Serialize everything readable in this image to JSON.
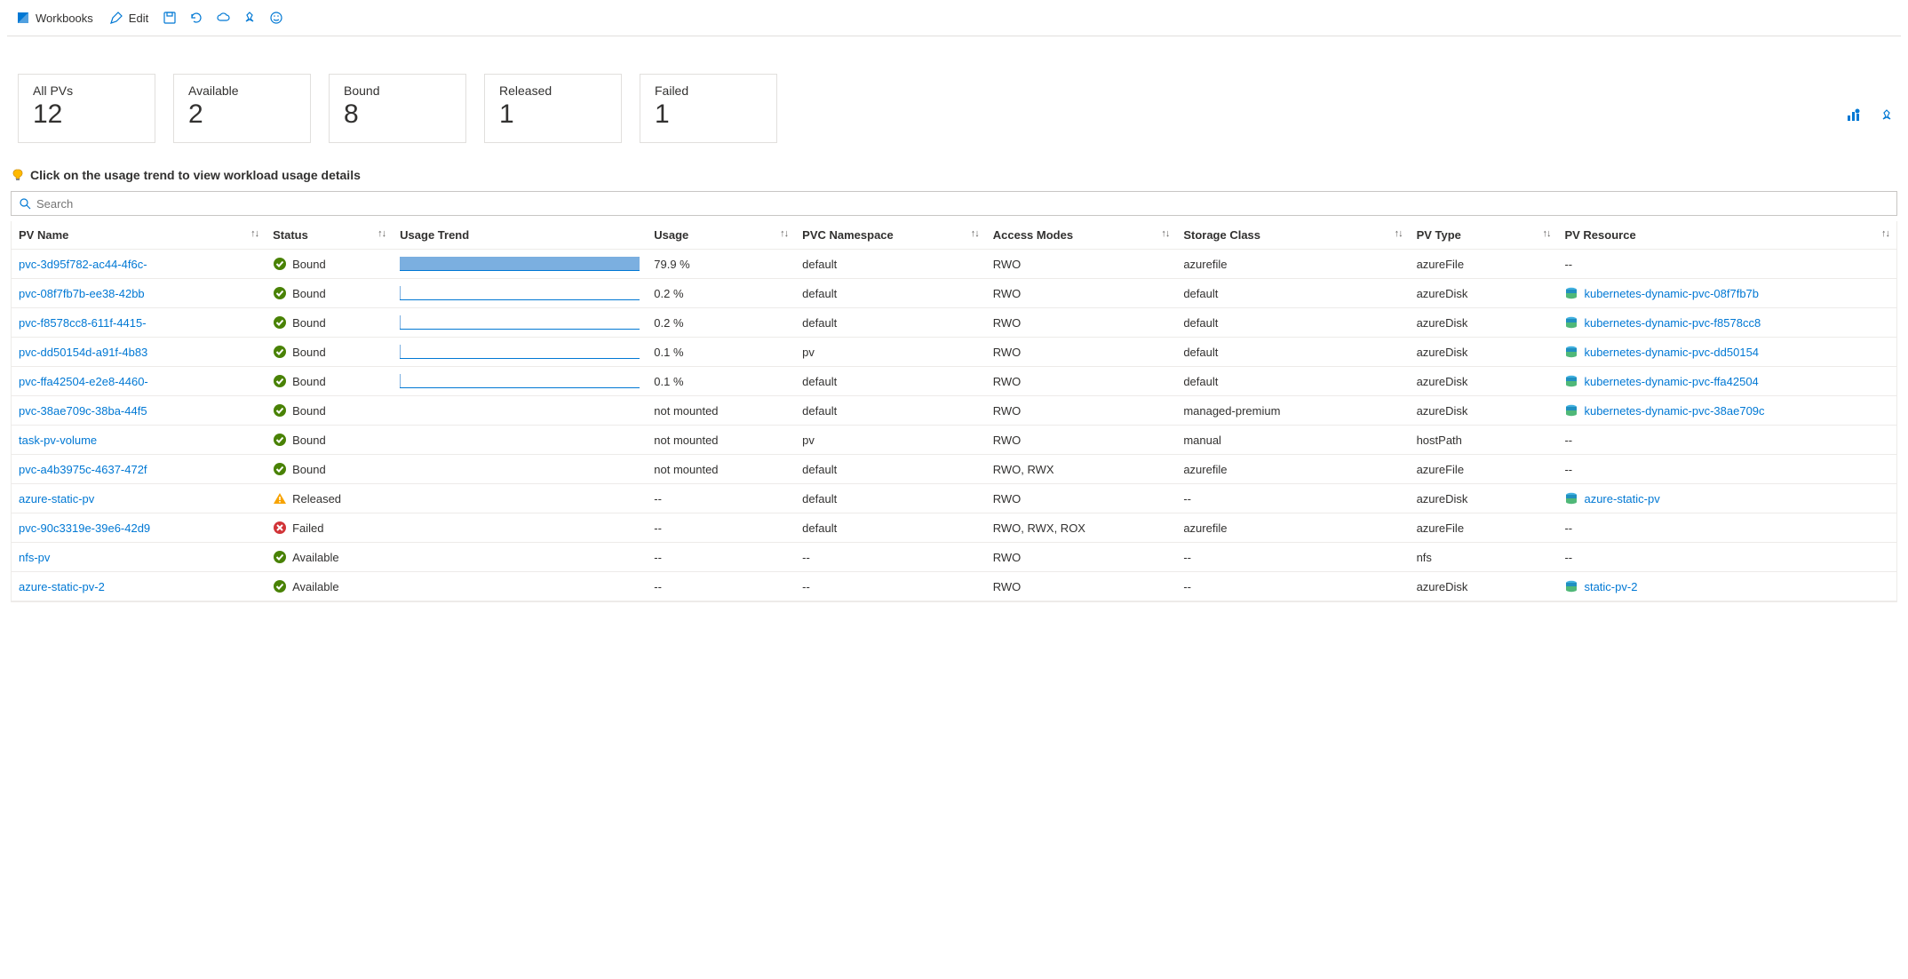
{
  "toolbar": {
    "workbooks_label": "Workbooks",
    "edit_label": "Edit"
  },
  "tiles": [
    {
      "label": "All PVs",
      "value": "12"
    },
    {
      "label": "Available",
      "value": "2"
    },
    {
      "label": "Bound",
      "value": "8"
    },
    {
      "label": "Released",
      "value": "1"
    },
    {
      "label": "Failed",
      "value": "1"
    }
  ],
  "hint": "Click on the usage trend to view workload usage details",
  "search": {
    "placeholder": "Search"
  },
  "columns": {
    "name": "PV Name",
    "status": "Status",
    "trend": "Usage Trend",
    "usage": "Usage",
    "ns": "PVC Namespace",
    "modes": "Access Modes",
    "class": "Storage Class",
    "type": "PV Type",
    "resource": "PV Resource"
  },
  "rows": [
    {
      "name": "pvc-3d95f782-ac44-4f6c-",
      "status": "Bound",
      "status_kind": "ok",
      "usage": "79.9 %",
      "usage_pct": 100,
      "ns": "default",
      "modes": "RWO",
      "class": "azurefile",
      "type": "azureFile",
      "resource": "--",
      "has_res": false
    },
    {
      "name": "pvc-08f7fb7b-ee38-42bb",
      "status": "Bound",
      "status_kind": "ok",
      "usage": "0.2 %",
      "usage_pct": 0.3,
      "ns": "default",
      "modes": "RWO",
      "class": "default",
      "type": "azureDisk",
      "resource": "kubernetes-dynamic-pvc-08f7fb7b",
      "has_res": true
    },
    {
      "name": "pvc-f8578cc8-611f-4415-",
      "status": "Bound",
      "status_kind": "ok",
      "usage": "0.2 %",
      "usage_pct": 0.3,
      "ns": "default",
      "modes": "RWO",
      "class": "default",
      "type": "azureDisk",
      "resource": "kubernetes-dynamic-pvc-f8578cc8",
      "has_res": true
    },
    {
      "name": "pvc-dd50154d-a91f-4b83",
      "status": "Bound",
      "status_kind": "ok",
      "usage": "0.1 %",
      "usage_pct": 0.15,
      "ns": "pv",
      "modes": "RWO",
      "class": "default",
      "type": "azureDisk",
      "resource": "kubernetes-dynamic-pvc-dd50154",
      "has_res": true
    },
    {
      "name": "pvc-ffa42504-e2e8-4460-",
      "status": "Bound",
      "status_kind": "ok",
      "usage": "0.1 %",
      "usage_pct": 0.15,
      "ns": "default",
      "modes": "RWO",
      "class": "default",
      "type": "azureDisk",
      "resource": "kubernetes-dynamic-pvc-ffa42504",
      "has_res": true
    },
    {
      "name": "pvc-38ae709c-38ba-44f5",
      "status": "Bound",
      "status_kind": "ok",
      "usage": "not mounted",
      "usage_pct": null,
      "ns": "default",
      "modes": "RWO",
      "class": "managed-premium",
      "type": "azureDisk",
      "resource": "kubernetes-dynamic-pvc-38ae709c",
      "has_res": true
    },
    {
      "name": "task-pv-volume",
      "status": "Bound",
      "status_kind": "ok",
      "usage": "not mounted",
      "usage_pct": null,
      "ns": "pv",
      "modes": "RWO",
      "class": "manual",
      "type": "hostPath",
      "resource": "--",
      "has_res": false
    },
    {
      "name": "pvc-a4b3975c-4637-472f",
      "status": "Bound",
      "status_kind": "ok",
      "usage": "not mounted",
      "usage_pct": null,
      "ns": "default",
      "modes": "RWO, RWX",
      "class": "azurefile",
      "type": "azureFile",
      "resource": "--",
      "has_res": false
    },
    {
      "name": "azure-static-pv",
      "status": "Released",
      "status_kind": "warn",
      "usage": "--",
      "usage_pct": null,
      "ns": "default",
      "modes": "RWO",
      "class": "--",
      "type": "azureDisk",
      "resource": "azure-static-pv",
      "has_res": true
    },
    {
      "name": "pvc-90c3319e-39e6-42d9",
      "status": "Failed",
      "status_kind": "fail",
      "usage": "--",
      "usage_pct": null,
      "ns": "default",
      "modes": "RWO, RWX, ROX",
      "class": "azurefile",
      "type": "azureFile",
      "resource": "--",
      "has_res": false
    },
    {
      "name": "nfs-pv",
      "status": "Available",
      "status_kind": "ok",
      "usage": "--",
      "usage_pct": null,
      "ns": "--",
      "modes": "RWO",
      "class": "--",
      "type": "nfs",
      "resource": "--",
      "has_res": false
    },
    {
      "name": "azure-static-pv-2",
      "status": "Available",
      "status_kind": "ok",
      "usage": "--",
      "usage_pct": null,
      "ns": "--",
      "modes": "RWO",
      "class": "--",
      "type": "azureDisk",
      "resource": "static-pv-2",
      "has_res": true
    }
  ]
}
